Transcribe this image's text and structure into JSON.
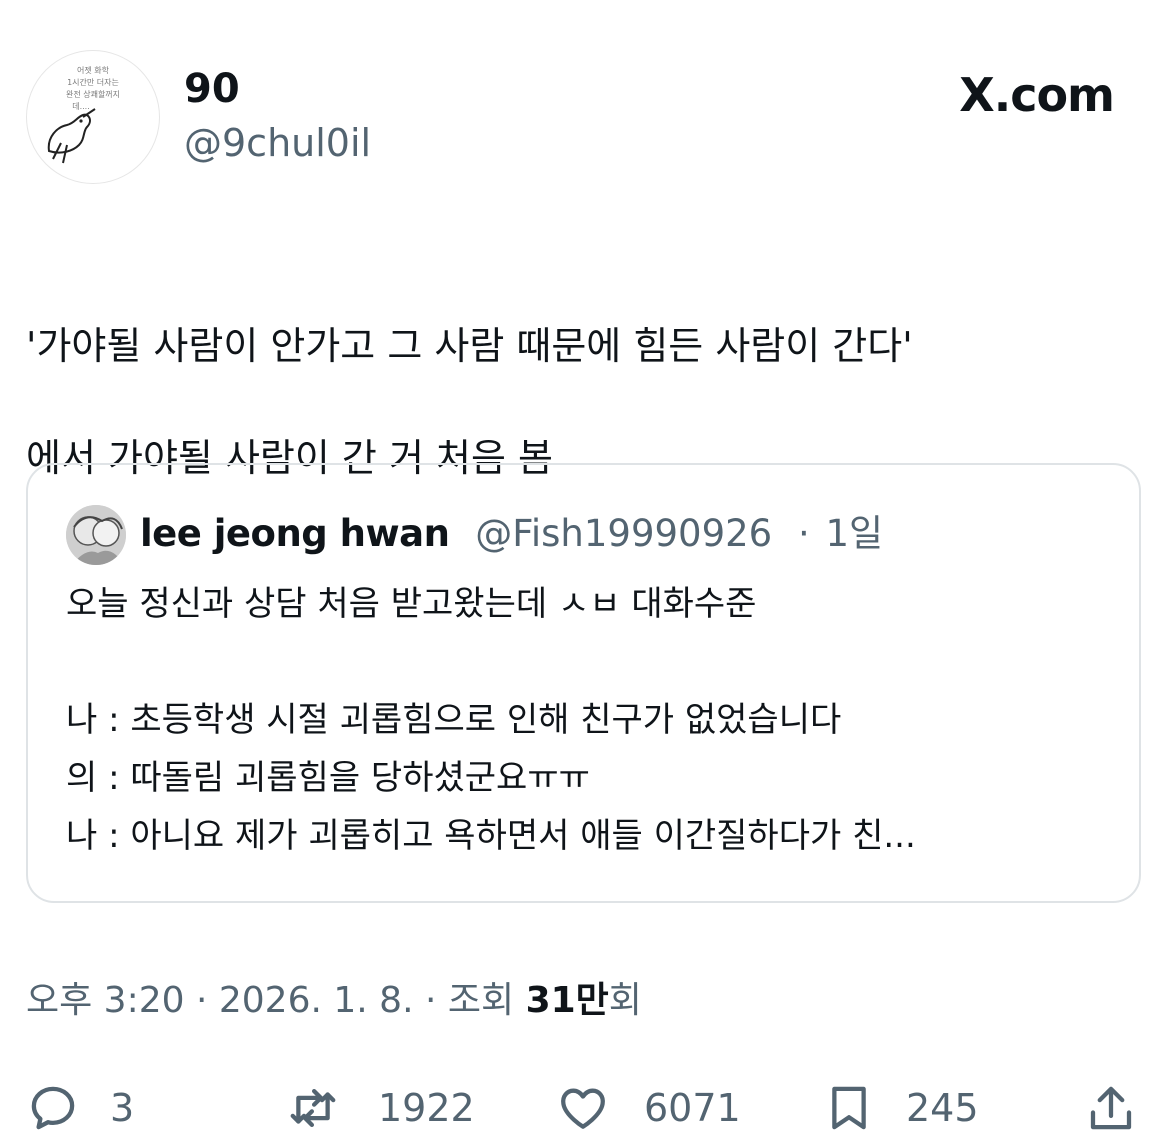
{
  "header": {
    "display_name": "90",
    "handle": "@9chul0il",
    "brand": "X.com",
    "avatar_caption_lines": [
      "어젯 화학",
      "1시간만 더자는",
      "완전 상쾌할꺼지",
      "데...."
    ]
  },
  "tweet": {
    "lines": [
      "'가야될 사람이 안가고 그 사람 때문에 힘든 사람이 간다'",
      "에서 가야될 사람이 간 거 처음 봄"
    ]
  },
  "quote": {
    "name": "lee jeong hwan",
    "handle": "@Fish19990926",
    "separator": "·",
    "time": "1일",
    "lines": [
      "오늘 정신과 상담 처음 받고왔는데 ㅅㅂ 대화수준",
      "",
      "나 : 초등학생 시절 괴롭힘으로 인해 친구가 없었습니다",
      "의 : 따돌림 괴롭힘을 당하셨군요ㅠㅠ",
      "나 : 아니요 제가 괴롭히고 욕하면서 애들 이간질하다가 친..."
    ]
  },
  "meta": {
    "time": "오후 3:20",
    "sep1": " · ",
    "date": "2026. 1. 8.",
    "sep2": " · ",
    "views_prefix": "조회 ",
    "views_value": "31만",
    "views_suffix": "회"
  },
  "actions": {
    "replies": "3",
    "retweets": "1922",
    "likes": "6071",
    "bookmarks": "245",
    "icons": [
      "reply-icon",
      "retweet-icon",
      "like-icon",
      "bookmark-icon",
      "share-icon"
    ]
  },
  "colors": {
    "text": "#0f1419",
    "secondary": "#536471",
    "border": "#dfe3e6"
  }
}
